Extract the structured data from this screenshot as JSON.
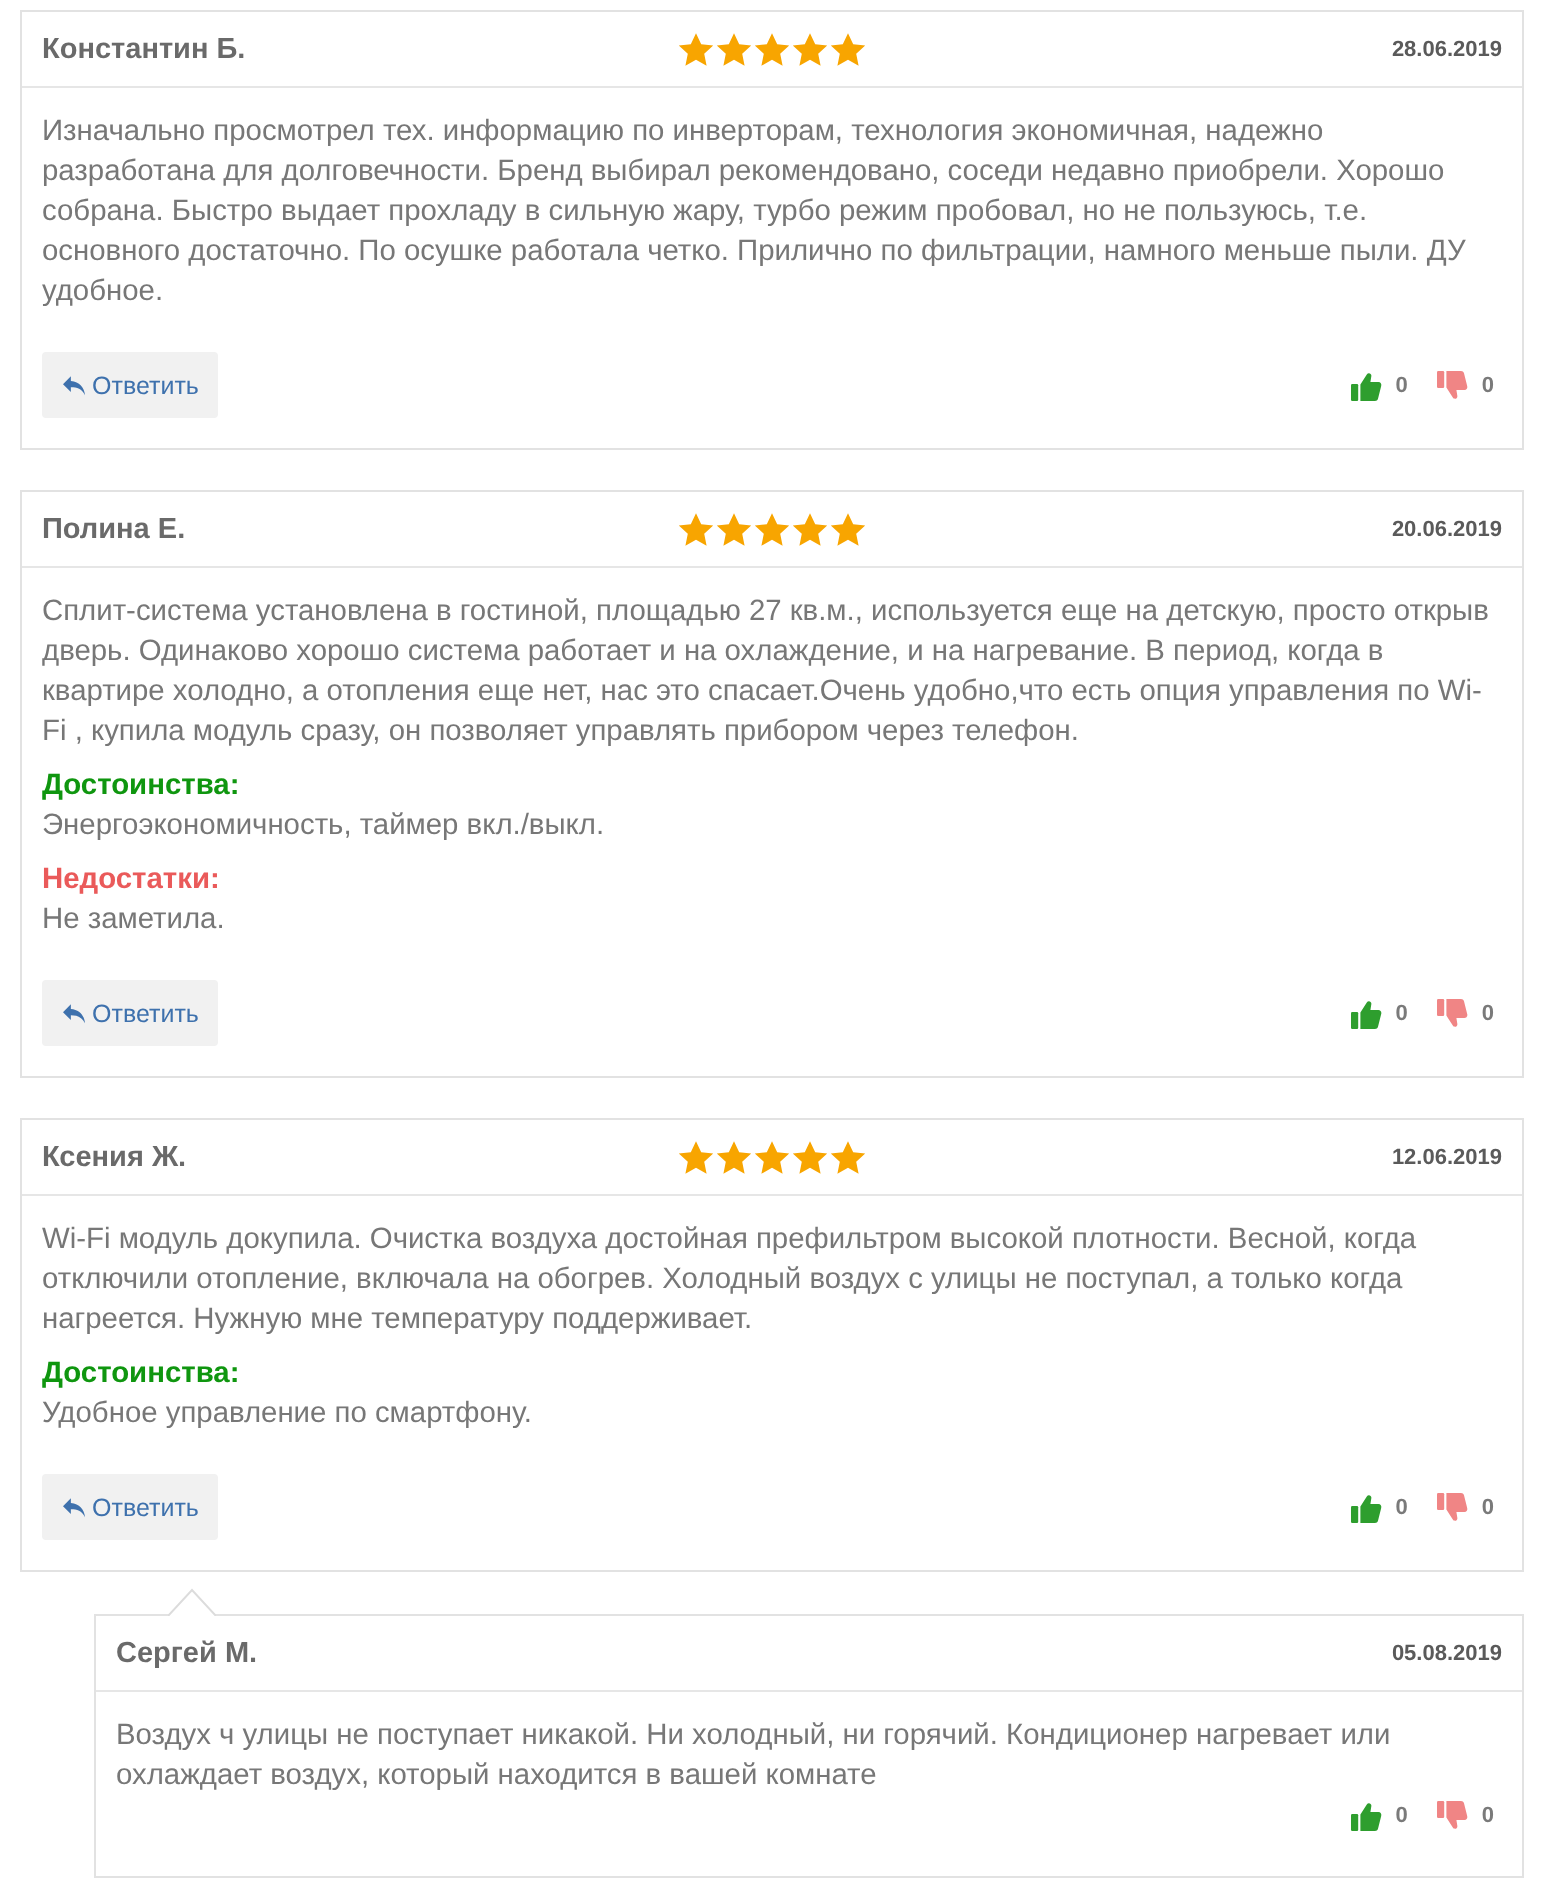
{
  "reviews": [
    {
      "author": "Константин Б.",
      "stars": 5,
      "date": "28.06.2019",
      "text": "Изначально просмотрел тех. информацию по инверторам, технология экономичная, надежно\nразработана для долговечности. Бренд выбирал рекомендовано, соседи недавно приобрели. Хорошо\nсобрана. Быстро выдает прохладу в сильную жару, турбо режим пробовал, но не пользуюсь, т.е.\nосновного достаточно. По осушке работала четко. Прилично по фильтрации, намного меньше пыли. ДУ удобное.",
      "reply_button": "Ответить",
      "likes": "0",
      "dislikes": "0"
    },
    {
      "author": "Полина Е.",
      "stars": 5,
      "date": "20.06.2019",
      "text": "Сплит-система установлена в гостиной, площадью 27 кв.м., используется еще на детскую, просто открыв дверь. Одинаково хорошо система работает и на охлаждение, и на нагревание. В период, когда в квартире холодно, а отопления еще нет, нас это спасает.Очень удобно,что есть опция управления по Wi-Fi , купила модуль сразу, он позволяет управлять прибором через телефон.",
      "sections": [
        {
          "kind": "pros",
          "label": "Достоинства:",
          "text": "Энергоэкономичность, таймер вкл./выкл."
        },
        {
          "kind": "cons",
          "label": "Недостатки:",
          "text": "Не заметила."
        }
      ],
      "reply_button": "Ответить",
      "likes": "0",
      "dislikes": "0"
    },
    {
      "author": "Ксения Ж.",
      "stars": 5,
      "date": "12.06.2019",
      "text": "Wi-Fi модуль докупила. Очистка воздуха достойная префильтром высокой плотности. Весной, когда отключили отопление, включала на обогрев. Холодный воздух с улицы не поступал, а только когда нагреется. Нужную мне температуру поддерживает.",
      "sections": [
        {
          "kind": "pros",
          "label": "Достоинства:",
          "text": "Удобное управление по смартфону."
        }
      ],
      "reply_button": "Ответить",
      "likes": "0",
      "dislikes": "0",
      "replies": [
        {
          "author": "Сергей М.",
          "date": "05.08.2019",
          "text": "Воздух ч улицы не поступает никакой. Ни холодный, ни горячий. Кондиционер нагревает или охлаждает воздух, который находится в вашей комнате",
          "likes": "0",
          "dislikes": "0"
        }
      ]
    }
  ]
}
